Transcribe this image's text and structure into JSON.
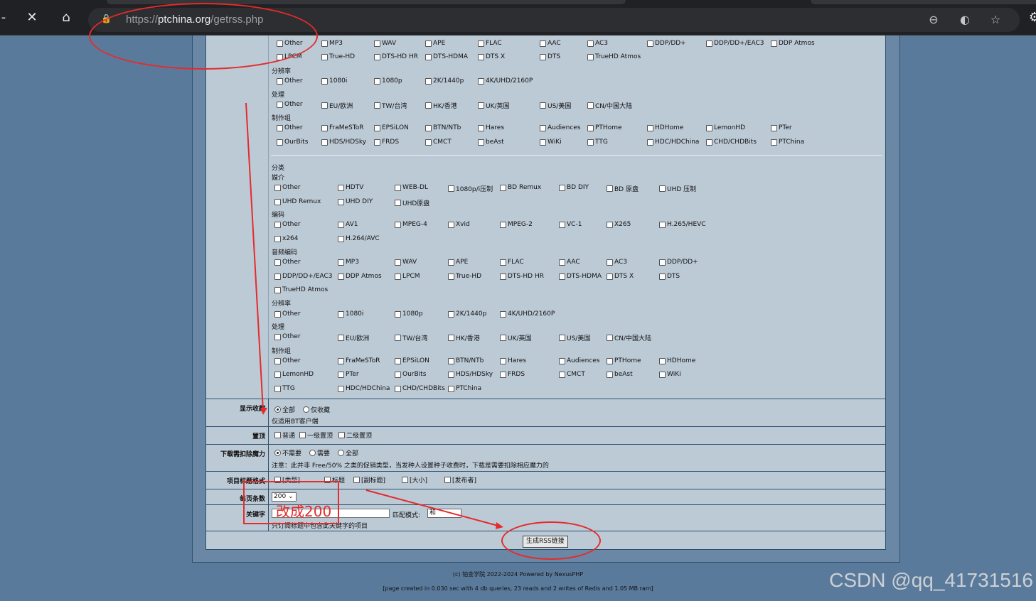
{
  "browser": {
    "url_prefix": "https://",
    "url_host": "ptchina.org",
    "url_path": "/getrss.php"
  },
  "upper": {
    "audio_row1": [
      "Other",
      "MP3",
      "WAV",
      "APE",
      "FLAC",
      "AAC",
      "AC3",
      "DDP/DD+",
      "DDP/DD+/EAC3",
      "DDP Atmos"
    ],
    "audio_row2": [
      "LPCM",
      "True-HD",
      "DTS-HD HR",
      "DTS-HDMA",
      "DTS X",
      "DTS",
      "TrueHD Atmos"
    ],
    "resolution_label": "分辨率",
    "resolution": [
      "Other",
      "1080i",
      "1080p",
      "2K/1440p",
      "4K/UHD/2160P"
    ],
    "processing_label": "处理",
    "processing": [
      "Other",
      "EU/欧洲",
      "TW/台湾",
      "HK/香港",
      "UK/英国",
      "US/美国",
      "CN/中国大陆"
    ],
    "group_label": "制作组",
    "group_row1": [
      "Other",
      "FraMeSToR",
      "EPSiLON",
      "BTN/NTb",
      "Hares",
      "Audiences",
      "PTHome",
      "HDHome",
      "LemonHD",
      "PTer"
    ],
    "group_row2": [
      "OurBits",
      "HDS/HDSky",
      "FRDS",
      "CMCT",
      "beAst",
      "WiKi",
      "TTG",
      "HDC/HDChina",
      "CHD/CHDBits",
      "PTChina"
    ]
  },
  "lower": {
    "category_label": "分类",
    "media_label": "媒介",
    "media_row1": [
      "Other",
      "HDTV",
      "WEB-DL",
      "1080p/i压制",
      "BD Remux",
      "BD DIY",
      "BD 原盘",
      "UHD 压制"
    ],
    "media_row2": [
      "UHD Remux",
      "UHD DIY",
      "UHD原盘"
    ],
    "codec_label": "编码",
    "codec_row1": [
      "Other",
      "AV1",
      "MPEG-4",
      "Xvid",
      "MPEG-2",
      "VC-1",
      "X265",
      "H.265/HEVC"
    ],
    "codec_row2": [
      "x264",
      "H.264/AVC"
    ],
    "audio_label": "音频编码",
    "audio_row1": [
      "Other",
      "MP3",
      "WAV",
      "APE",
      "FLAC",
      "AAC",
      "AC3",
      "DDP/DD+"
    ],
    "audio_row2": [
      "DDP/DD+/EAC3",
      "DDP Atmos",
      "LPCM",
      "True-HD",
      "DTS-HD HR",
      "DTS-HDMA",
      "DTS X",
      "DTS"
    ],
    "audio_row3": [
      "TrueHD Atmos"
    ],
    "resolution_label": "分辨率",
    "resolution": [
      "Other",
      "1080i",
      "1080p",
      "2K/1440p",
      "4K/UHD/2160P"
    ],
    "processing_label": "处理",
    "processing": [
      "Other",
      "EU/欧洲",
      "TW/台湾",
      "HK/香港",
      "UK/英国",
      "US/美国",
      "CN/中国大陆"
    ],
    "group_label": "制作组",
    "group_row1": [
      "Other",
      "FraMeSToR",
      "EPSiLON",
      "BTN/NTb",
      "Hares",
      "Audiences",
      "PTHome",
      "HDHome"
    ],
    "group_row2": [
      "LemonHD",
      "PTer",
      "OurBits",
      "HDS/HDSky",
      "FRDS",
      "CMCT",
      "beAst",
      "WiKi"
    ],
    "group_row3": [
      "TTG",
      "HDC/HDChina",
      "CHD/CHDBits",
      "PTChina"
    ]
  },
  "form": {
    "show_fav_label": "显示收藏",
    "show_all": "全部",
    "show_fav_only": "仅收藏",
    "show_note": "仅适用BT客户端",
    "sticky_label": "置顶",
    "sticky_opts": [
      "普通",
      "一级置顶",
      "二级置顶"
    ],
    "magic_label": "下载需扣除魔力",
    "magic_opts": [
      "不需要",
      "需要",
      "全部"
    ],
    "magic_note": "注意：此并非 Free/50% 之类的促销类型，当发种人设置种子收费时，下载是需要扣除相应魔力的",
    "title_format_label": "项目标题格式",
    "title_format_opts": [
      "[类型]",
      "标题",
      "[副标题]",
      "[大小]",
      "[发布者]"
    ],
    "per_page_label": "每页条数",
    "per_page_value": "200",
    "keyword_label": "关键字",
    "match_mode_label": "匹配模式:",
    "match_mode_value": "和",
    "keyword_note": "只订阅标题中包含此关键字的项目",
    "generate_button": "生成RSS链接"
  },
  "footer": {
    "line1": "(c) 铂金学院 2022-2024 Powered by NexusPHP",
    "line2": "[page created in 0.030 sec with 4 db queries, 23 reads and 2 writes of Redis and 1.05 MB ram]"
  },
  "annotation": {
    "text": "改成200",
    "color": "#e52b2b"
  },
  "watermark": "CSDN @qq_41731516"
}
